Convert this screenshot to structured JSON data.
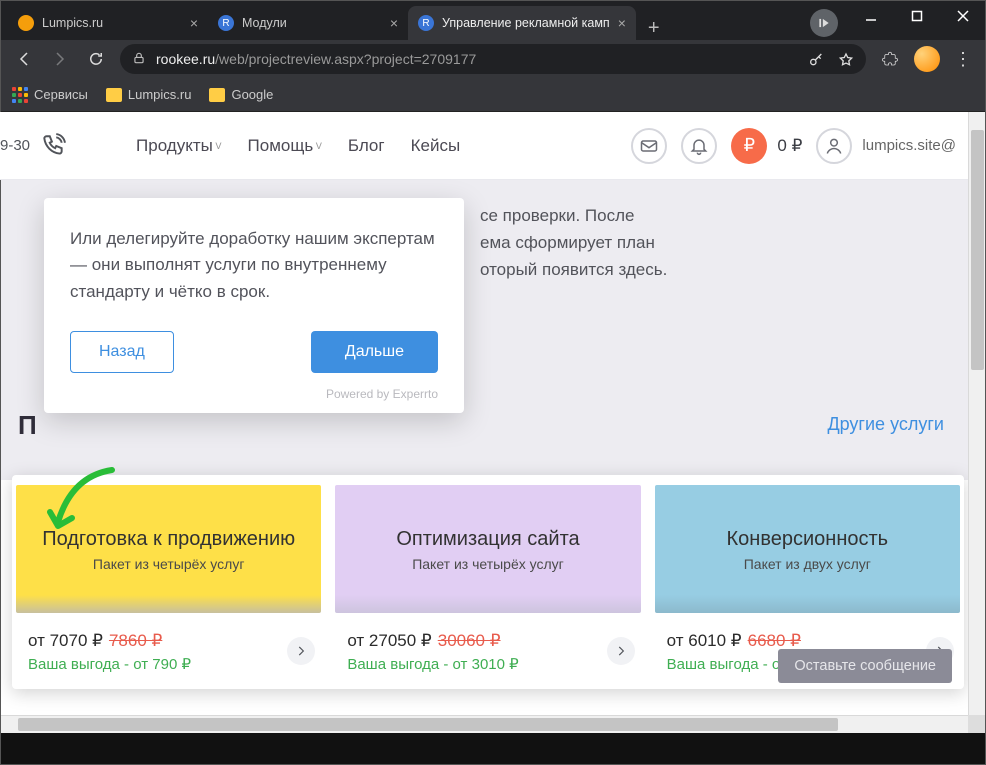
{
  "window": {
    "min": "—",
    "max": "▢",
    "close": "✕"
  },
  "tabs": {
    "items": [
      {
        "title": "Lumpics.ru",
        "fav_bg": "#f59e0b"
      },
      {
        "title": "Модули",
        "fav_bg": "#3a75d6"
      },
      {
        "title": "Управление рекламной камп",
        "fav_bg": "#3a75d6"
      }
    ],
    "new": "+"
  },
  "addr": {
    "host": "rookee.ru",
    "path": "/web/projectreview.aspx?project=2709177"
  },
  "bookmarks": {
    "apps": "Сервисы",
    "items": [
      "Lumpics.ru",
      "Google"
    ]
  },
  "header": {
    "phone_fragment": "9-30",
    "menu": {
      "products": "Продукты",
      "help": "Помощь",
      "blog": "Блог",
      "cases": "Кейсы"
    },
    "balance": {
      "symbol": "₽",
      "text": "0 ₽"
    },
    "user": "lumpics.site@"
  },
  "bg_lines": {
    "l1": "се проверки. После",
    "l2": "ема сформирует план",
    "l3": "оторый появится здесь."
  },
  "popup": {
    "text": "Или делегируйте доработку нашим экспертам — они выполнят услуги по внутреннему стандарту и чётко в срок.",
    "back": "Назад",
    "next": "Дальше",
    "credit": "Powered by Experrto"
  },
  "section_title": "П",
  "other_services": "Другие услуги",
  "cards": [
    {
      "title": "Подготовка к продвижению",
      "sub": "Пакет из четырёх услуг",
      "price_prefix": "от 7070 ₽",
      "old": "7860 ₽",
      "benefit": "Ваша выгода - от 790 ₽"
    },
    {
      "title": "Оптимизация сайта",
      "sub": "Пакет из четырёх услуг",
      "price_prefix": "от 27050 ₽",
      "old": "30060 ₽",
      "benefit": "Ваша выгода - от 3010 ₽"
    },
    {
      "title": "Конверсионность",
      "sub": "Пакет из двух услуг",
      "price_prefix": "от 6010 ₽",
      "old": "6680 ₽",
      "benefit": "Ваша выгода - от 670 ₽"
    }
  ],
  "chat": "Оставьте сообщение"
}
